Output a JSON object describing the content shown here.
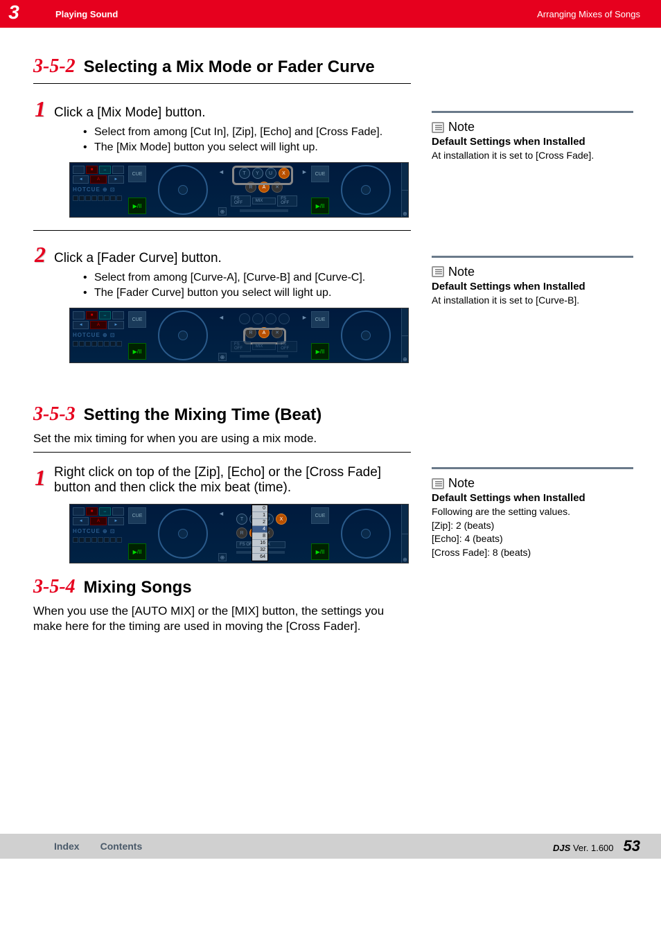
{
  "header": {
    "chapter_number": "3",
    "section_title": "Playing Sound",
    "page_context": "Arranging Mixes of Songs"
  },
  "section_352": {
    "number": "3-5-2",
    "title": "Selecting a Mix Mode or Fader Curve",
    "step1": {
      "num": "1",
      "title": "Click a [Mix Mode] button.",
      "bullets": [
        "Select from among [Cut In], [Zip], [Echo] and [Cross Fade].",
        "The [Mix Mode] button you select will light up."
      ]
    },
    "step2": {
      "num": "2",
      "title": "Click a [Fader Curve] button.",
      "bullets": [
        "Select from among [Curve-A], [Curve-B] and [Curve-C].",
        "The [Fader Curve] button you select will light up."
      ]
    }
  },
  "section_353": {
    "number": "3-5-3",
    "title": "Setting the Mixing Time (Beat)",
    "intro": "Set the mix timing for when you are using a mix mode.",
    "step1": {
      "num": "1",
      "title": "Right click on top of the [Zip], [Echo] or the [Cross Fade] button and then click the mix beat (time)."
    },
    "dropdown": [
      "0",
      "1",
      "2",
      "4",
      "8",
      "16",
      "32",
      "64"
    ],
    "dropdown_selected": "4"
  },
  "section_354": {
    "number": "3-5-4",
    "title": "Mixing Songs",
    "body": " When you use the [AUTO MIX] or the [MIX] button, the settings you make here for the timing are used in moving the [Cross Fader]."
  },
  "notes": {
    "note1": {
      "label": "Note",
      "subtitle": "Default Settings when Installed",
      "text": "At installation it is set to [Cross Fade]."
    },
    "note2": {
      "label": "Note",
      "subtitle": "Default Settings when Installed",
      "text": "At installation it is set to [Curve-B]."
    },
    "note3": {
      "label": "Note",
      "subtitle": "Default Settings when Installed",
      "lines": [
        "Following are the setting values.",
        "[Zip]: 2 (beats)",
        "[Echo]: 4 (beats)",
        "[Cross Fade]: 8 (beats)"
      ]
    }
  },
  "ui": {
    "cue": "CUE",
    "play": "▶/II",
    "hotcue": "HOTCUE",
    "fs_off": "FS OFF",
    "mix": "MIX",
    "letters": {
      "t": "T",
      "y": "Y",
      "u": "U",
      "x": "X",
      "r": "R",
      "a": "A"
    }
  },
  "footer": {
    "index": "Index",
    "contents": "Contents",
    "product": "DJS",
    "version_label": "Ver. 1.600",
    "page": "53"
  }
}
